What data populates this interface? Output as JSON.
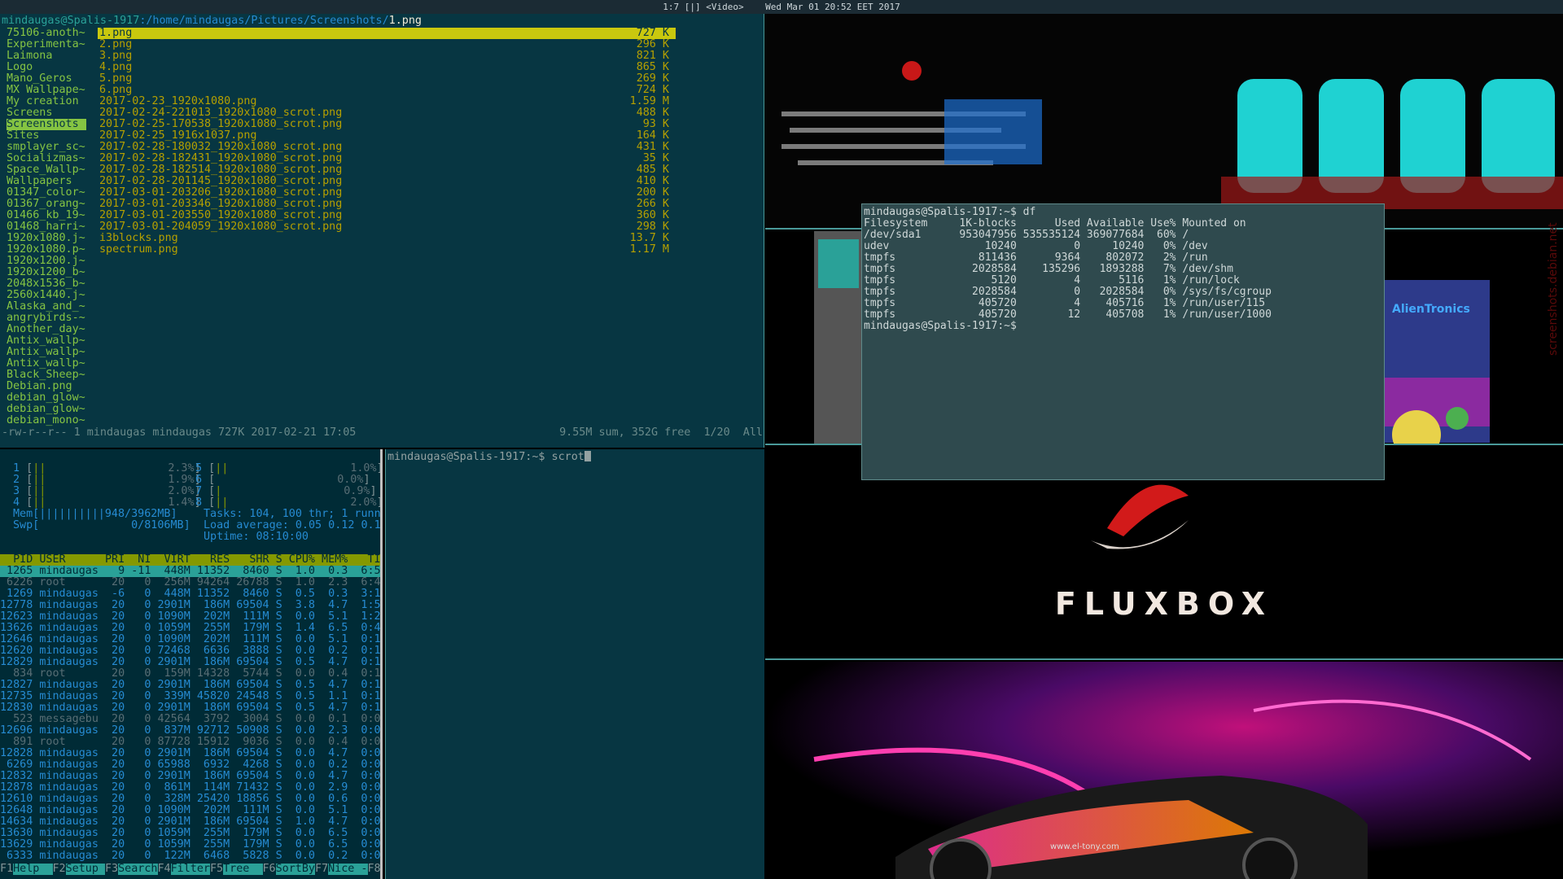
{
  "topbar": {
    "text": "1:7 [|] <Video>    Wed Mar 01 20:52 EET 2017"
  },
  "ranger": {
    "path_user": "mindaugas@Spalis-1917",
    "path_dir": ":/home/mindaugas/Pictures/Screenshots/",
    "path_file": "1.png",
    "dirs": [
      "75106-anoth~",
      "Experimenta~",
      "Laimona",
      "Logo",
      "Mano_Geros",
      "MX Wallpape~",
      "My creation",
      "Screens",
      "Screenshots",
      "Sites",
      "smplayer_sc~",
      "Socializmas~",
      "Space_Wallp~",
      "Wallpapers",
      "01347_color~",
      "01367_orang~",
      "01466_kb_19~",
      "01468_harri~",
      "1920x1080.j~",
      "1920x1080.p~",
      "1920x1200.j~",
      "1920x1200_b~",
      "2048x1536_b~",
      "2560x1440.j~",
      "Alaska_and_~",
      "angrybirds-~",
      "Another_day~",
      "Antix_wallp~",
      "Antix_wallp~",
      "Antix_wallp~",
      "Black_Sheep~",
      "Debian.png",
      "debian_glow~",
      "debian_glow~",
      "debian_mono~"
    ],
    "files": [
      {
        "name": "1.png",
        "size": "727 K"
      },
      {
        "name": "2.png",
        "size": "296 K"
      },
      {
        "name": "3.png",
        "size": "821 K"
      },
      {
        "name": "4.png",
        "size": "865 K"
      },
      {
        "name": "5.png",
        "size": "269 K"
      },
      {
        "name": "6.png",
        "size": "724 K"
      },
      {
        "name": "2017-02-23_1920x1080.png",
        "size": "1.59 M"
      },
      {
        "name": "2017-02-24-221013_1920x1080_scrot.png",
        "size": "488 K"
      },
      {
        "name": "2017-02-25-170538_1920x1080_scrot.png",
        "size": "93 K"
      },
      {
        "name": "2017-02-25_1916x1037.png",
        "size": "164 K"
      },
      {
        "name": "2017-02-28-180032_1920x1080_scrot.png",
        "size": "431 K"
      },
      {
        "name": "2017-02-28-182431_1920x1080_scrot.png",
        "size": "35 K"
      },
      {
        "name": "2017-02-28-182514_1920x1080_scrot.png",
        "size": "485 K"
      },
      {
        "name": "2017-02-28-201145_1920x1080_scrot.png",
        "size": "410 K"
      },
      {
        "name": "2017-03-01-203206_1920x1080_scrot.png",
        "size": "200 K"
      },
      {
        "name": "2017-03-01-203346_1920x1080_scrot.png",
        "size": "266 K"
      },
      {
        "name": "2017-03-01-203550_1920x1080_scrot.png",
        "size": "360 K"
      },
      {
        "name": "2017-03-01-204059_1920x1080_scrot.png",
        "size": "298 K"
      },
      {
        "name": "i3blocks.png",
        "size": "13.7 K"
      },
      {
        "name": "spectrum.png",
        "size": "1.17 M"
      }
    ],
    "status_left": "-rw-r--r-- 1 mindaugas mindaugas 727K 2017-02-21 17:05",
    "status_right": "9.55M sum, 352G free  1/20  All"
  },
  "htop": {
    "cpus": [
      {
        "n": "1",
        "bar": "||",
        "pct": "2.3%"
      },
      {
        "n": "2",
        "bar": "||",
        "pct": "1.9%"
      },
      {
        "n": "3",
        "bar": "||",
        "pct": "2.0%"
      },
      {
        "n": "4",
        "bar": "||",
        "pct": "1.4%"
      },
      {
        "n": "5",
        "bar": "||",
        "pct": "1.0%"
      },
      {
        "n": "6",
        "bar": "",
        "pct": "0.0%"
      },
      {
        "n": "7",
        "bar": "|",
        "pct": "0.9%"
      },
      {
        "n": "8",
        "bar": "||",
        "pct": "2.0%"
      }
    ],
    "mem": "Mem[||||||||||948/3962MB]",
    "swp": "Swp[              0/8106MB]",
    "tasks": "Tasks: 104, 100 thr; 1 runn",
    "load": "Load average: 0.05 0.12 0.1",
    "uptime": "Uptime: 08:10:00",
    "header": "  PID USER      PRI  NI  VIRT   RES   SHR S CPU% MEM%   TI",
    "rows": [
      " 1265 mindaugas   9 -11  448M 11352  8460 S  1.0  0.3  6:5",
      " 6226 root       20   0  256M 94264 26788 S  1.0  2.3  6:4",
      " 1269 mindaugas  -6   0  448M 11352  8460 S  0.5  0.3  3:1",
      "12778 mindaugas  20   0 2901M  186M 69504 S  3.8  4.7  1:5",
      "12623 mindaugas  20   0 1090M  202M  111M S  0.0  5.1  1:2",
      "13626 mindaugas  20   0 1059M  255M  179M S  1.4  6.5  0:4",
      "12646 mindaugas  20   0 1090M  202M  111M S  0.0  5.1  0:1",
      "12620 mindaugas  20   0 72468  6636  3888 S  0.0  0.2  0:1",
      "12829 mindaugas  20   0 2901M  186M 69504 S  0.5  4.7  0:1",
      "  834 root       20   0  159M 14328  5744 S  0.0  0.4  0:1",
      "12827 mindaugas  20   0 2901M  186M 69504 S  0.5  4.7  0:1",
      "12735 mindaugas  20   0  339M 45820 24548 S  0.5  1.1  0:1",
      "12830 mindaugas  20   0 2901M  186M 69504 S  0.5  4.7  0:1",
      "  523 messagebu  20   0 42564  3792  3004 S  0.0  0.1  0:0",
      "12696 mindaugas  20   0  837M 92712 50908 S  0.0  2.3  0:0",
      "  891 root       20   0 87728 15912  9036 S  0.0  0.4  0:0",
      "12828 mindaugas  20   0 2901M  186M 69504 S  0.0  4.7  0:0",
      " 6269 mindaugas  20   0 65988  6932  4268 S  0.0  0.2  0:0",
      "12832 mindaugas  20   0 2901M  186M 69504 S  0.0  4.7  0:0",
      "12878 mindaugas  20   0  861M  114M 71432 S  0.0  2.9  0:0",
      "12610 mindaugas  20   0  328M 25420 18856 S  0.0  0.6  0:0",
      "12648 mindaugas  20   0 1090M  202M  111M S  0.0  5.1  0:0",
      "14634 mindaugas  20   0 2901M  186M 69504 S  1.0  4.7  0:0",
      "13630 mindaugas  20   0 1059M  255M  179M S  0.0  6.5  0:0",
      "13629 mindaugas  20   0 1059M  255M  179M S  0.0  6.5  0:0",
      " 6333 mindaugas  20   0  122M  6468  5828 S  0.0  0.2  0:0"
    ],
    "footer": [
      {
        "k": "F1",
        "l": "Help  "
      },
      {
        "k": "F2",
        "l": "Setup "
      },
      {
        "k": "F3",
        "l": "Search"
      },
      {
        "k": "F4",
        "l": "Filter"
      },
      {
        "k": "F5",
        "l": "Tree  "
      },
      {
        "k": "F6",
        "l": "SortBy"
      },
      {
        "k": "F7",
        "l": "Nice -"
      },
      {
        "k": "F8",
        "l": ""
      }
    ]
  },
  "term2": {
    "prompt": "mindaugas@Spalis-1917:~$ scrot"
  },
  "dfterm": {
    "lines": [
      "mindaugas@Spalis-1917:~$ df",
      "Filesystem     1K-blocks      Used Available Use% Mounted on",
      "/dev/sda1      953047956 535535124 369077684  60% /",
      "udev               10240         0     10240   0% /dev",
      "tmpfs             811436      9364    802072   2% /run",
      "tmpfs            2028584    135296   1893288   7% /dev/shm",
      "tmpfs               5120         4      5116   1% /run/lock",
      "tmpfs            2028584         0   2028584   0% /sys/fs/cgroup",
      "tmpfs             405720         4    405716   1% /run/user/115",
      "tmpfs             405720        12    405708   1% /run/user/1000",
      "mindaugas@Spalis-1917:~$ "
    ]
  },
  "wallpaper": {
    "flux_text": "FLUXBOX",
    "alien_text": "AlienTronics",
    "watermark": "screenshots.debian.net",
    "car_site": "www.el-tony.com"
  }
}
